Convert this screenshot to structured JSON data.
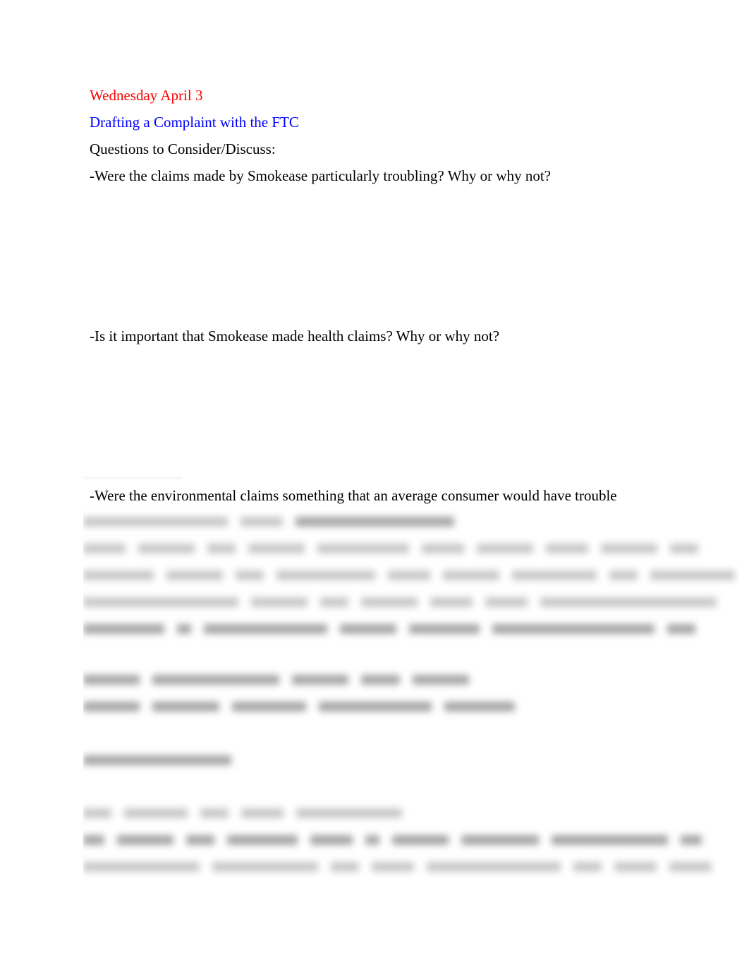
{
  "document": {
    "date_heading": "Wednesday April 3",
    "title": "Drafting a Complaint with the FTC",
    "intro": "Questions to Consider/Discuss:",
    "questions": [
      "-Were the claims made by Smokease particularly troubling? Why or why not?",
      "-Is it important that Smokease made health claims? Why or why not?",
      "-Were the environmental claims something that an average consumer would have trouble"
    ],
    "colors": {
      "date_heading": "#ff0000",
      "title": "#0000ff",
      "body": "#000000"
    },
    "obscured_content": "blurred (unreadable)"
  }
}
